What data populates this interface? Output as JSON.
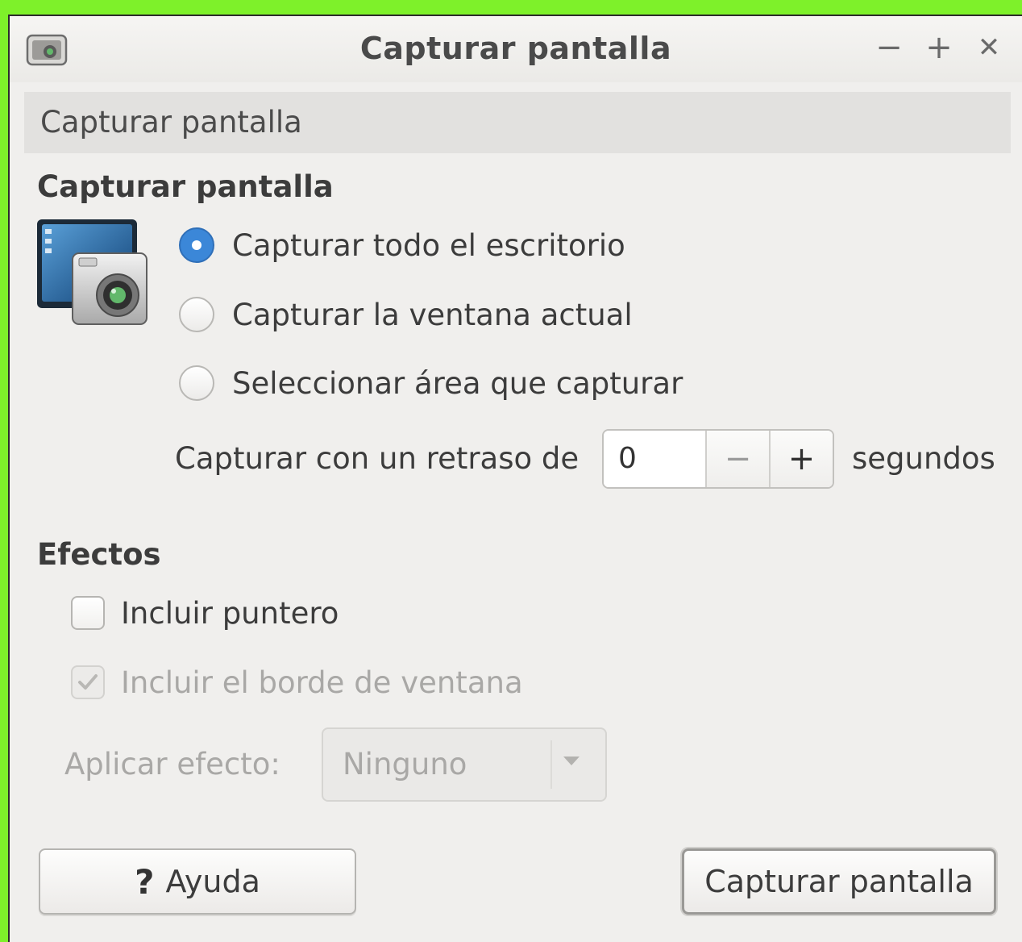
{
  "window": {
    "title": "Capturar pantalla"
  },
  "window_controls": {
    "minimize": "−",
    "maximize": "+",
    "close": "✕"
  },
  "banner": {
    "label": "Capturar pantalla"
  },
  "capture": {
    "heading": "Capturar pantalla",
    "options": [
      {
        "label": "Capturar todo el escritorio",
        "selected": true
      },
      {
        "label": "Capturar la ventana actual",
        "selected": false
      },
      {
        "label": "Seleccionar área que capturar",
        "selected": false
      }
    ],
    "delay_label": "Capturar con un retraso de",
    "delay_value": "0",
    "delay_decrement": "−",
    "delay_increment": "+",
    "delay_unit": "segundos"
  },
  "effects": {
    "heading": "Efectos",
    "include_pointer": {
      "label": "Incluir puntero",
      "checked": false
    },
    "include_border": {
      "label": "Incluir el borde de ventana",
      "checked": true,
      "disabled": true
    },
    "apply_effect_label": "Aplicar efecto:",
    "apply_effect_value": "Ninguno"
  },
  "buttons": {
    "help_icon": "?",
    "help": "Ayuda",
    "capture": "Capturar pantalla"
  },
  "colors": {
    "accent": "#3b87d8",
    "background": "#f0efed",
    "frame": "#7ef12a"
  }
}
